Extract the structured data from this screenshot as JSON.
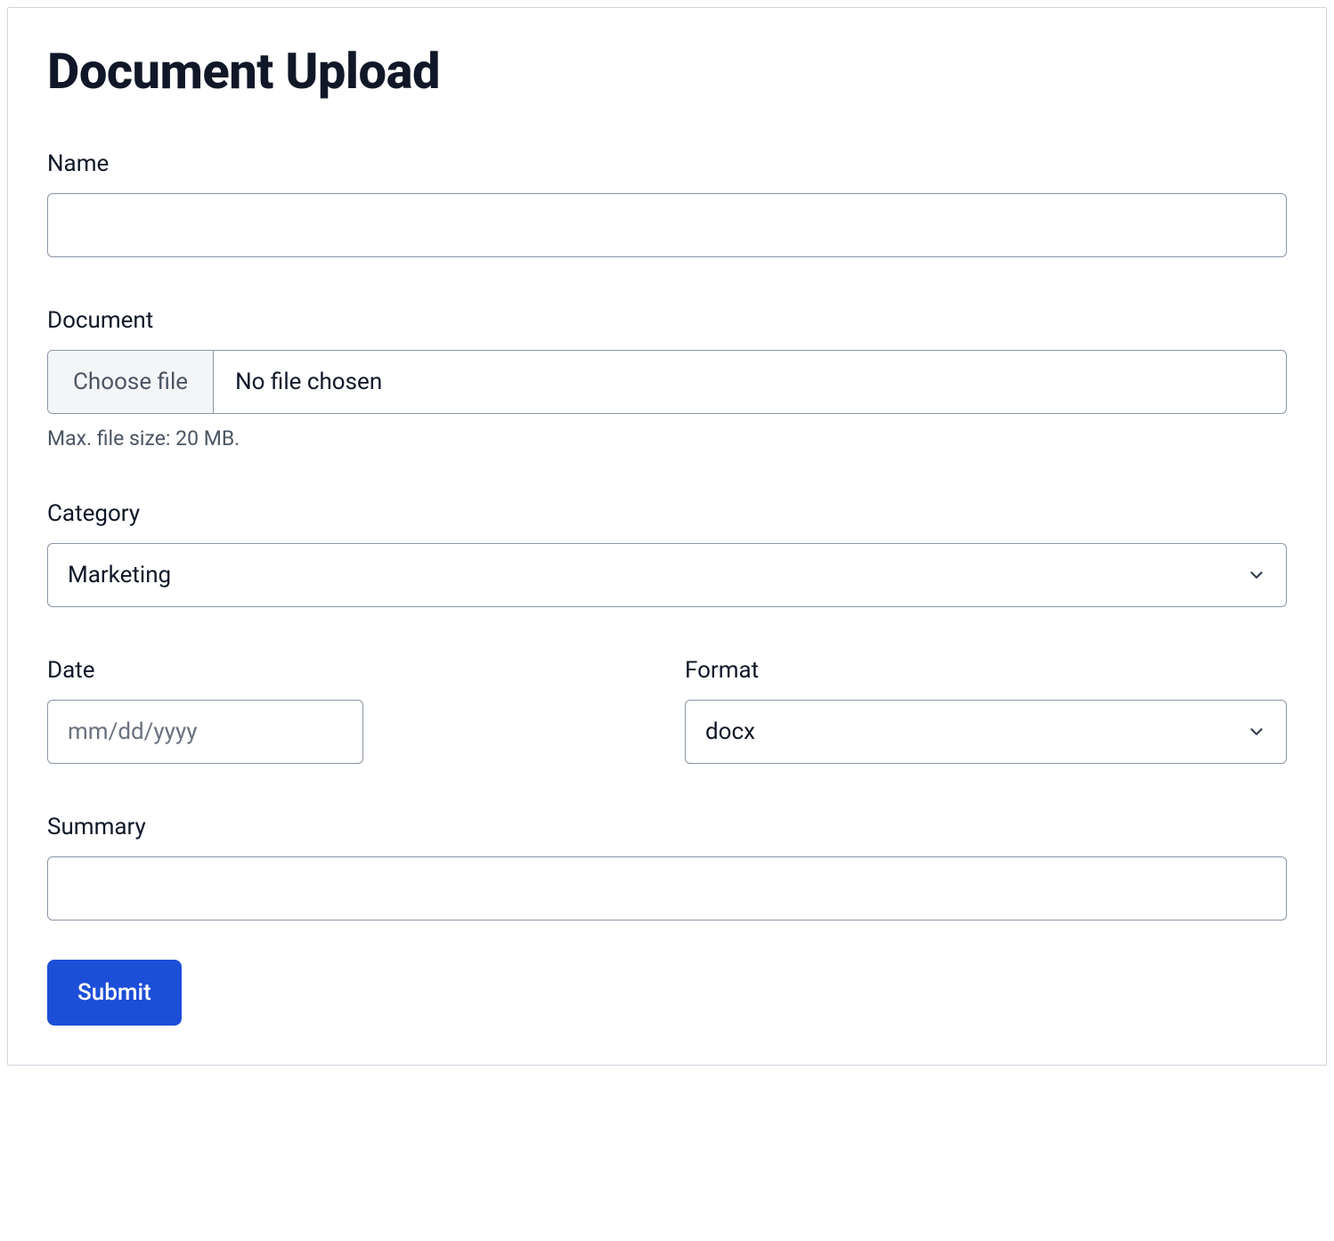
{
  "title": "Document Upload",
  "fields": {
    "name": {
      "label": "Name",
      "value": ""
    },
    "document": {
      "label": "Document",
      "choose_button": "Choose file",
      "status": "No file chosen",
      "help": "Max. file size: 20 MB."
    },
    "category": {
      "label": "Category",
      "value": "Marketing"
    },
    "date": {
      "label": "Date",
      "placeholder": "mm/dd/yyyy"
    },
    "format": {
      "label": "Format",
      "value": "docx"
    },
    "summary": {
      "label": "Summary",
      "value": ""
    }
  },
  "submit_label": "Submit"
}
